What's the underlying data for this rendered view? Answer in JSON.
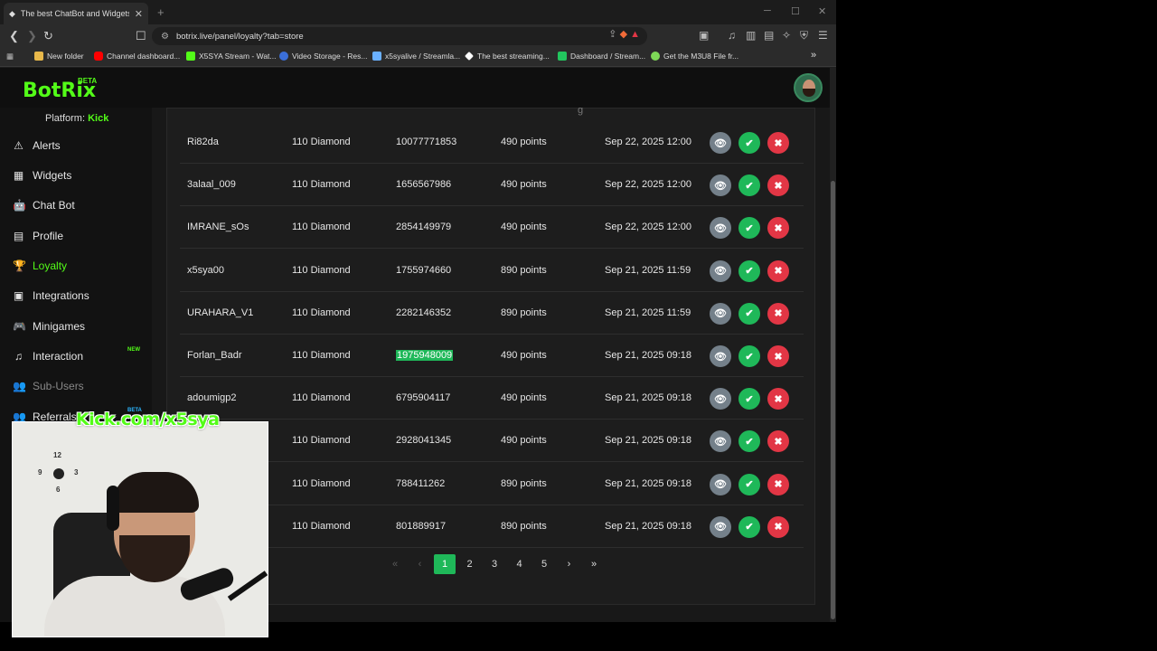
{
  "browser": {
    "tab_title": "The best ChatBot and Widgets f...",
    "tab_close": "✕",
    "new_tab": "+",
    "url": "botrix.live/panel/loyalty?tab=store",
    "bookmarks": [
      {
        "label": "New folder",
        "color": "#e8b84a"
      },
      {
        "label": "Channel dashboard...",
        "color": "#ff0000"
      },
      {
        "label": "X5SYA Stream - Wat...",
        "color": "#53fc18"
      },
      {
        "label": "Video Storage - Res...",
        "color": "#3b6fd8"
      },
      {
        "label": "x5syalive / Streamla...",
        "color": "#6ab0ff"
      },
      {
        "label": "The best streaming...",
        "color": "#ffffff"
      },
      {
        "label": "Dashboard / Stream...",
        "color": "#22c55e"
      },
      {
        "label": "Get the M3U8 File fr...",
        "color": "#7ed957"
      }
    ],
    "more": "»"
  },
  "app": {
    "logo": "BotRix",
    "logo_beta": "BETA",
    "platform_label": "Platform:",
    "platform_name": "Kick",
    "nav": [
      {
        "label": "Alerts",
        "icon": "⚠",
        "state": "normal"
      },
      {
        "label": "Widgets",
        "icon": "▦",
        "state": "normal"
      },
      {
        "label": "Chat Bot",
        "icon": "🤖",
        "state": "normal"
      },
      {
        "label": "Profile",
        "icon": "▤",
        "state": "normal"
      },
      {
        "label": "Loyalty",
        "icon": "🏆",
        "state": "active"
      },
      {
        "label": "Integrations",
        "icon": "▣",
        "state": "normal"
      },
      {
        "label": "Minigames",
        "icon": "🎮",
        "state": "normal"
      },
      {
        "label": "Interaction",
        "icon": "♫",
        "state": "normal"
      },
      {
        "label": "Sub-Users",
        "icon": "👥",
        "state": "dim"
      },
      {
        "label": "Referrals",
        "icon": "👥",
        "state": "normal"
      }
    ],
    "new_badge": "NEW",
    "beta_badge": "BETA",
    "header_fragment": "g"
  },
  "rows": [
    {
      "user": "Ri82da",
      "item": "110 Diamond",
      "id": "10077771853",
      "cost": "490 points",
      "date": "Sep 22, 2025 12:00"
    },
    {
      "user": "3alaal_009",
      "item": "110 Diamond",
      "id": "1656567986",
      "cost": "490 points",
      "date": "Sep 22, 2025 12:00"
    },
    {
      "user": "IMRANE_sOs",
      "item": "110 Diamond",
      "id": "2854149979",
      "cost": "490 points",
      "date": "Sep 22, 2025 12:00"
    },
    {
      "user": "x5sya00",
      "item": "110 Diamond",
      "id": "1755974660",
      "cost": "890 points",
      "date": "Sep 21, 2025 11:59"
    },
    {
      "user": "URAHARA_V1",
      "item": "110 Diamond",
      "id": "2282146352",
      "cost": "890 points",
      "date": "Sep 21, 2025 11:59"
    },
    {
      "user": "Forlan_Badr",
      "item": "110 Diamond",
      "id": "1975948009",
      "cost": "490 points",
      "date": "Sep 21, 2025 09:18",
      "highlight": true
    },
    {
      "user": "adoumigp2",
      "item": "110 Diamond",
      "id": "6795904117",
      "cost": "490 points",
      "date": "Sep 21, 2025 09:18"
    },
    {
      "user": "",
      "item": "110 Diamond",
      "id": "2928041345",
      "cost": "490 points",
      "date": "Sep 21, 2025 09:18"
    },
    {
      "user": "",
      "item": "110 Diamond",
      "id": "788411262",
      "cost": "890 points",
      "date": "Sep 21, 2025 09:18"
    },
    {
      "user": "",
      "item": "110 Diamond",
      "id": "801889917",
      "cost": "890 points",
      "date": "Sep 21, 2025 09:18"
    }
  ],
  "actions": {
    "view_icon": "👁",
    "approve_icon": "✔",
    "reject_icon": "✖"
  },
  "pagination": {
    "first": "«",
    "prev": "‹",
    "pages": [
      "1",
      "2",
      "3",
      "4",
      "5"
    ],
    "current": "1",
    "next": "›",
    "last": "»"
  },
  "webcam": {
    "label": "Kick.com/x5sya",
    "clock": {
      "n12": "12",
      "n3": "3",
      "n6": "6",
      "n9": "9"
    }
  },
  "colors": {
    "brand": "#53fc18",
    "approve": "#1fb859",
    "reject": "#e23645",
    "view": "#74808a"
  }
}
